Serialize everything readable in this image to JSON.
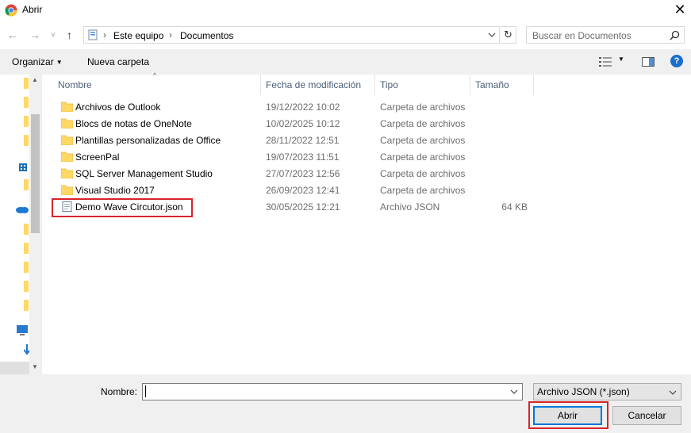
{
  "window": {
    "title": "Abrir",
    "close_glyph": "✕"
  },
  "nav": {
    "back_glyph": "←",
    "forward_glyph": "→",
    "recent_glyph": "˅",
    "up_glyph": "↑",
    "breadcrumb": [
      "Este equipo",
      "Documentos"
    ],
    "crumb_sep": "›",
    "refresh_glyph": "↻",
    "search_placeholder": "Buscar en Documentos"
  },
  "toolbar": {
    "organize_label": "Organizar",
    "organize_caret": "▼",
    "new_folder_label": "Nueva carpeta",
    "view_caret": "▼",
    "help_label": "?"
  },
  "columns": {
    "name": "Nombre",
    "date": "Fecha de modificación",
    "type": "Tipo",
    "size": "Tamaño",
    "sort_caret": "^"
  },
  "files": [
    {
      "name": "Archivos de Outlook",
      "date": "19/12/2022 10:02",
      "type": "Carpeta de archivos",
      "size": "",
      "icon": "folder-icon"
    },
    {
      "name": "Blocs de notas de OneNote",
      "date": "10/02/2025 10:12",
      "type": "Carpeta de archivos",
      "size": "",
      "icon": "folder-icon"
    },
    {
      "name": "Plantillas personalizadas de Office",
      "date": "28/11/2022 12:51",
      "type": "Carpeta de archivos",
      "size": "",
      "icon": "folder-icon"
    },
    {
      "name": "ScreenPal",
      "date": "19/07/2023 11:51",
      "type": "Carpeta de archivos",
      "size": "",
      "icon": "folder-icon"
    },
    {
      "name": "SQL Server Management Studio",
      "date": "27/07/2023 12:56",
      "type": "Carpeta de archivos",
      "size": "",
      "icon": "folder-icon"
    },
    {
      "name": "Visual Studio 2017",
      "date": "26/09/2023 12:41",
      "type": "Carpeta de archivos",
      "size": "",
      "icon": "folder-icon"
    },
    {
      "name": "Demo Wave Circutor.json",
      "date": "30/05/2025 12:21",
      "type": "Archivo JSON",
      "size": "64 KB",
      "icon": "json-file-icon"
    }
  ],
  "footer": {
    "filename_label": "Nombre:",
    "filename_value": "",
    "filetype_value": "Archivo JSON (*.json)",
    "open_label": "Abrir",
    "cancel_label": "Cancelar"
  },
  "colors": {
    "highlight": "#d8232a",
    "folder": "#ffd866",
    "accent": "#0078d7",
    "header_text": "#4c607a"
  }
}
